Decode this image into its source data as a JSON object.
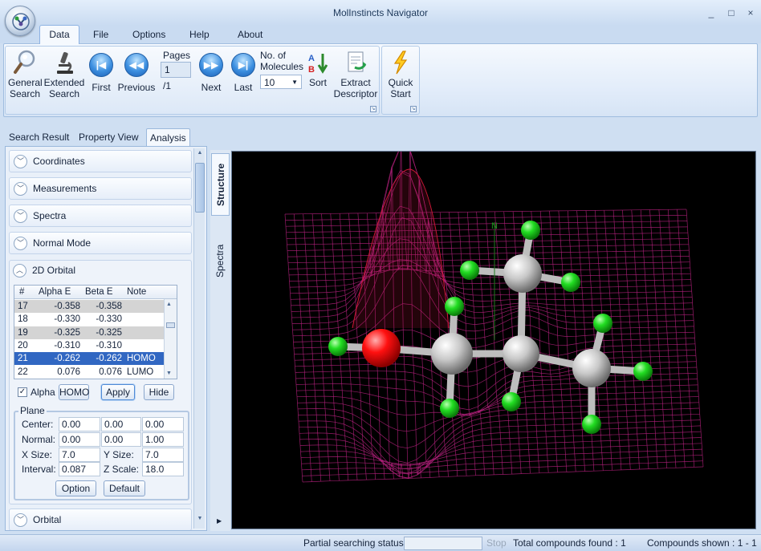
{
  "window": {
    "title": "MolInstincts Navigator",
    "controls": [
      "_",
      "□",
      "×"
    ]
  },
  "menu": {
    "tabs": [
      "Data",
      "File",
      "Options",
      "Help",
      "About"
    ],
    "active": "Data"
  },
  "ribbon": {
    "general_search": [
      "General",
      "Search"
    ],
    "extended_search": [
      "Extended",
      "Search"
    ],
    "first": "First",
    "previous": "Previous",
    "pages_label": "Pages",
    "page_value": "1",
    "page_total": "/1",
    "next": "Next",
    "last": "Last",
    "molecules_label": [
      "No. of",
      "Molecules"
    ],
    "molecules_value": "10",
    "sort": "Sort",
    "extract_descriptor": [
      "Extract",
      "Descriptor"
    ],
    "quick_start": [
      "Quick",
      "Start"
    ]
  },
  "view_tabs": [
    "Search Result",
    "Property View",
    "Analysis"
  ],
  "accordion": {
    "coordinates": "Coordinates",
    "measurements": "Measurements",
    "spectra": "Spectra",
    "normal_mode": "Normal Mode",
    "orbital_2d": "2D Orbital",
    "orbital": "Orbital"
  },
  "orbital_grid": {
    "headers": [
      "#",
      "Alpha E",
      "Beta E",
      "Note"
    ],
    "rows": [
      {
        "num": "17",
        "alpha": "-0.358",
        "beta": "-0.358",
        "note": ""
      },
      {
        "num": "18",
        "alpha": "-0.330",
        "beta": "-0.330",
        "note": ""
      },
      {
        "num": "19",
        "alpha": "-0.325",
        "beta": "-0.325",
        "note": ""
      },
      {
        "num": "20",
        "alpha": "-0.310",
        "beta": "-0.310",
        "note": ""
      },
      {
        "num": "21",
        "alpha": "-0.262",
        "beta": "-0.262",
        "note": "HOMO"
      },
      {
        "num": "22",
        "alpha": "0.076",
        "beta": "0.076",
        "note": "LUMO"
      }
    ],
    "selected_num": "21"
  },
  "orbital_controls": {
    "alpha_label": "Alpha",
    "alpha_checked": true,
    "homo_button": "HOMO",
    "apply_button": "Apply",
    "hide_button": "Hide"
  },
  "plane": {
    "title": "Plane",
    "center_label": "Center:",
    "center": [
      "0.00",
      "0.00",
      "0.00"
    ],
    "normal_label": "Normal:",
    "normal": [
      "0.00",
      "0.00",
      "1.00"
    ],
    "xsize_label": "X Size:",
    "xsize": "7.0",
    "ysize_label": "Y Size:",
    "ysize": "7.0",
    "interval_label": "Interval:",
    "interval": "0.087",
    "zscale_label": "Z Scale:",
    "zscale": "18.0",
    "option_button": "Option",
    "default_button": "Default"
  },
  "viewer_tabs": [
    "Structure",
    "Spectra"
  ],
  "viewer": {
    "axis_label": "N"
  },
  "status": {
    "partial_label": "Partial searching status :",
    "stop": "Stop",
    "total_found": "Total compounds found : 1",
    "shown": "Compounds shown : 1 - 1"
  },
  "colors": {
    "selected_row": "#3167c2",
    "mesh": "#b0207a",
    "oxygen": "#ff1010",
    "hydrogen": "#22dd22",
    "carbon": "#c8c8c8"
  }
}
